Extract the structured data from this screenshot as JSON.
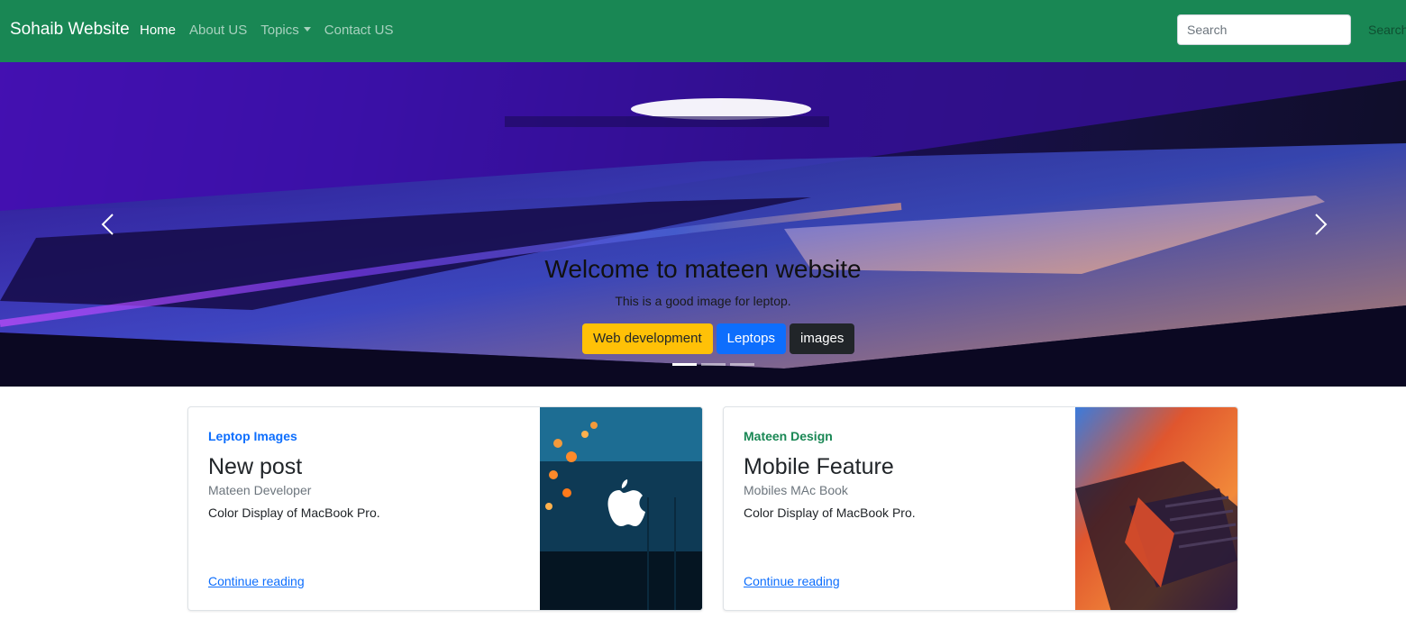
{
  "navbar": {
    "brand": "Sohaib Website",
    "links": [
      {
        "label": "Home",
        "active": true
      },
      {
        "label": "About US",
        "active": false
      },
      {
        "label": "Topics",
        "active": false,
        "dropdown": true
      },
      {
        "label": "Contact US",
        "active": false
      }
    ],
    "search_placeholder": "Search",
    "search_button": "Search",
    "background": "#198754"
  },
  "carousel": {
    "title": "Welcome to mateen website",
    "subtitle": "This is a good image for leptop.",
    "buttons": [
      {
        "label": "Web development",
        "style": "warning",
        "color": "#ffc107"
      },
      {
        "label": "Leptops",
        "style": "primary",
        "color": "#0d6efd"
      },
      {
        "label": "images",
        "style": "dark",
        "color": "#212529"
      }
    ],
    "indicators": 3,
    "active_indicator": 0,
    "prev_icon": "chevron-left-icon",
    "next_icon": "chevron-right-icon"
  },
  "cards": [
    {
      "category": "Leptop Images",
      "category_color": "#0d6efd",
      "title": "New post",
      "meta": "Mateen Developer",
      "text": "Color Display of MacBook Pro.",
      "link": "Continue reading"
    },
    {
      "category": "Mateen Design",
      "category_color": "#198754",
      "title": "Mobile Feature",
      "meta": "Mobiles MAc Book",
      "text": "Color Display of MacBook Pro.",
      "link": "Continue reading"
    }
  ]
}
